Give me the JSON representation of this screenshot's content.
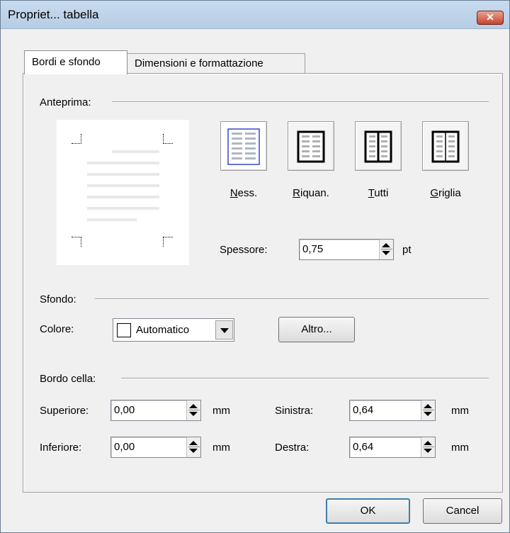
{
  "window": {
    "title": "Propriet... tabella",
    "close_glyph": "✕"
  },
  "tabs": [
    {
      "label": "Bordi e sfondo",
      "active": true
    },
    {
      "label": "Dimensioni e formattazione",
      "active": false
    }
  ],
  "preview": {
    "section_label": "Anteprima:",
    "presets": [
      {
        "label_u": "N",
        "label_rest": "ess.",
        "icon": "no-border-icon",
        "selected": true
      },
      {
        "label_u": "R",
        "label_rest": "iquan.",
        "icon": "outer-border-icon",
        "selected": false
      },
      {
        "label_u": "T",
        "label_rest": "utti",
        "icon": "all-borders-icon",
        "selected": false
      },
      {
        "label_u": "G",
        "label_rest": "riglia",
        "icon": "grid-icon",
        "selected": false
      }
    ],
    "thickness_label": "Spessore:",
    "thickness_value": "0,75",
    "thickness_unit": "pt"
  },
  "background": {
    "section_label": "Sfondo:",
    "color_label": "Colore:",
    "color_value": "Automatico",
    "more_button": "Altro..."
  },
  "cell_border": {
    "section_label": "Bordo cella:",
    "top_label": "Superiore:",
    "top_value": "0,00",
    "bottom_label": "Inferiore:",
    "bottom_value": "0,00",
    "left_label": "Sinistra:",
    "left_value": "0,64",
    "right_label": "Destra:",
    "right_value": "0,64",
    "unit": "mm"
  },
  "footer": {
    "ok": "OK",
    "cancel": "Cancel"
  },
  "colors": {
    "selected_preset_border": "#3c46c8",
    "titlebar": "#bfd4ea"
  }
}
